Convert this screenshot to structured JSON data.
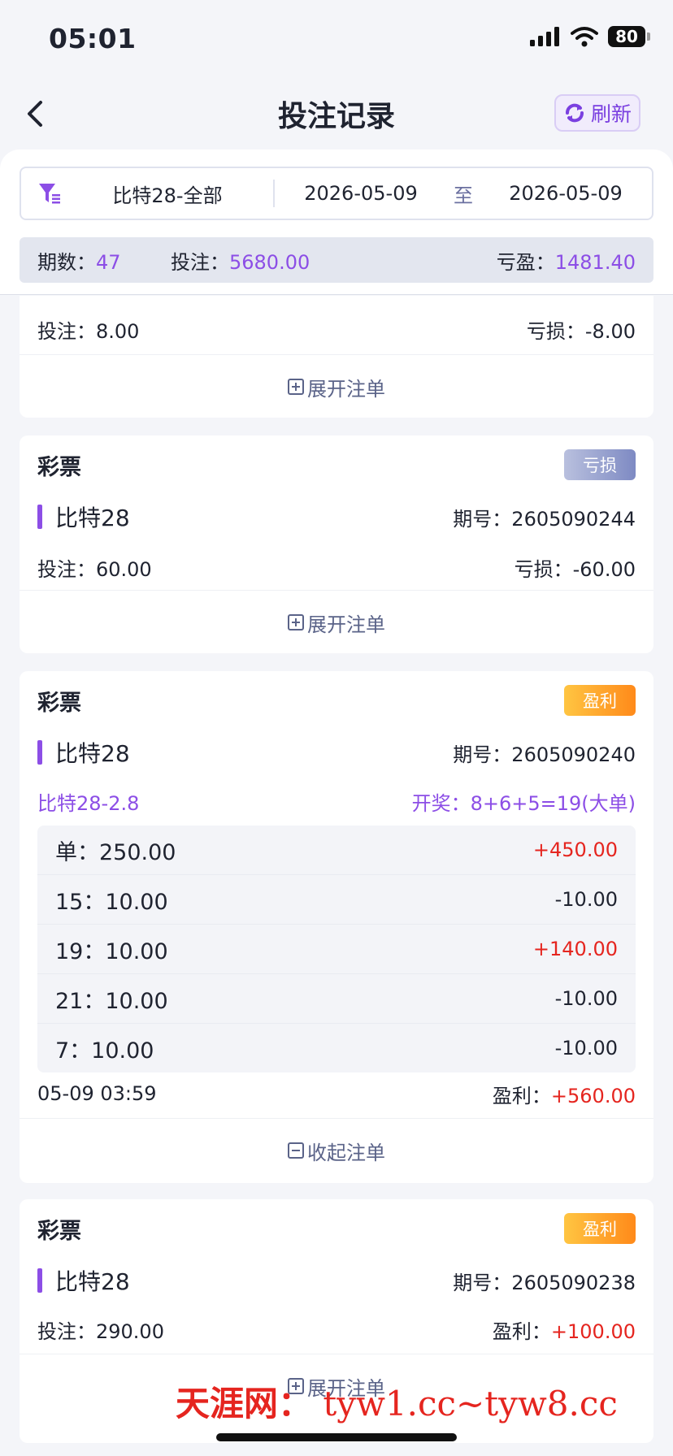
{
  "status": {
    "time": "05:01",
    "battery": "80"
  },
  "header": {
    "title": "投注记录",
    "refresh_label": "刷新"
  },
  "filter": {
    "game": "比特28-全部",
    "date_start": "2026-05-09",
    "to": "至",
    "date_end": "2026-05-09"
  },
  "summary": {
    "periods_label": "期数：",
    "periods": "47",
    "bet_label": "投注：",
    "bet": "5680.00",
    "pl_label": "亏盈：",
    "pl": "1481.40"
  },
  "cards": [
    {
      "bet": "投注：8.00",
      "result": "亏损：-8.00",
      "toggle": "展开注单"
    },
    {
      "title": "彩票",
      "badge": "亏损",
      "game": "比特28",
      "period": "期号：2605090244",
      "bet": "投注：60.00",
      "result": "亏损：-60.00",
      "toggle": "展开注单"
    },
    {
      "title": "彩票",
      "badge": "盈利",
      "game": "比特28",
      "period": "期号：2605090240",
      "play": "比特28-2.8",
      "draw": "开奖：8+6+5=19(大单)",
      "bets": [
        {
          "item": "单：250.00",
          "result": "+450.00"
        },
        {
          "item": "15：10.00",
          "result": "-10.00"
        },
        {
          "item": "19：10.00",
          "result": "+140.00"
        },
        {
          "item": "21：10.00",
          "result": "-10.00"
        },
        {
          "item": "7：10.00",
          "result": "-10.00"
        }
      ],
      "time": "05-09 03:59",
      "profit_label": "盈利：",
      "profit": "+560.00",
      "toggle": "收起注单"
    },
    {
      "title": "彩票",
      "badge": "盈利",
      "game": "比特28",
      "period": "期号：2605090238",
      "bet": "投注：290.00",
      "result_label": "盈利：",
      "result_value": "+100.00",
      "toggle": "展开注单"
    }
  ],
  "watermark": {
    "cn": "天涯网：",
    "url": "tyw1.cc~tyw8.cc"
  },
  "colors": {
    "accent": "#8c4ee6",
    "profit": "#e5251f",
    "win_badge": "#ff8a1a",
    "loss_badge": "#7e8ac3"
  }
}
